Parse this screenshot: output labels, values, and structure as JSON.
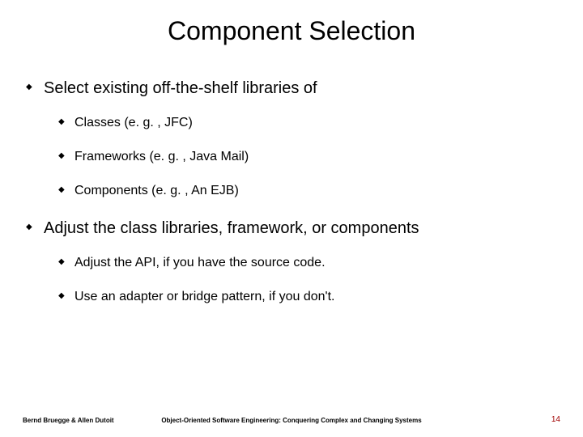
{
  "title": "Component Selection",
  "bullets": {
    "b1": {
      "text": "Select existing off-the-shelf libraries of",
      "sub": {
        "s1": "Classes (e. g. , JFC)",
        "s2": "Frameworks (e. g. , Java Mail)",
        "s3": "Components (e. g. , An EJB)"
      }
    },
    "b2": {
      "text": "Adjust the class libraries, framework, or components",
      "sub": {
        "s1": "Adjust the API, if you have the source code.",
        "s2": "Use an adapter or bridge pattern, if you don't."
      }
    }
  },
  "footer": {
    "left": "Bernd Bruegge & Allen Dutoit",
    "center": "Object-Oriented Software Engineering: Conquering Complex and Changing Systems",
    "right": "14"
  }
}
